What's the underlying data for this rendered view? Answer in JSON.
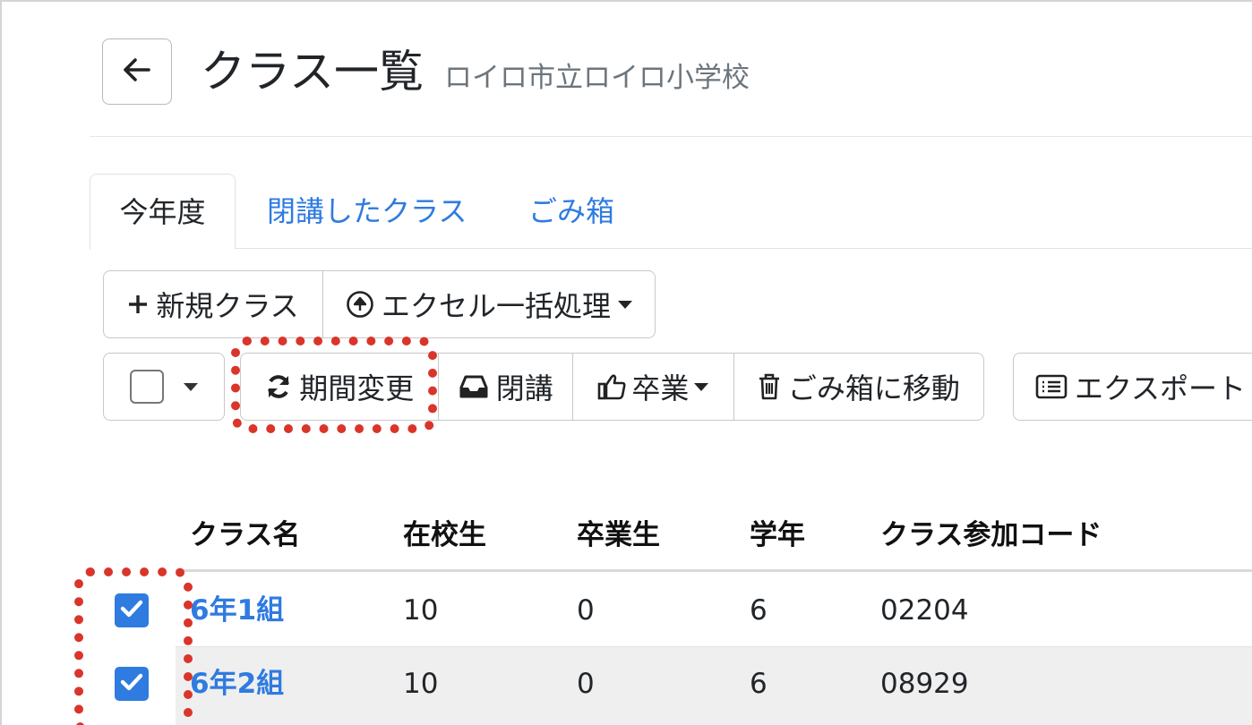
{
  "header": {
    "title": "クラス一覧",
    "school": "ロイロ市立ロイロ小学校"
  },
  "tabs": [
    {
      "label": "今年度",
      "active": true
    },
    {
      "label": "閉講したクラス",
      "active": false
    },
    {
      "label": "ごみ箱",
      "active": false
    }
  ],
  "toolbar": {
    "new_class": "新規クラス",
    "excel_bulk": "エクセル一括処理",
    "period_change": "期間変更",
    "close_class": "閉講",
    "graduate": "卒業",
    "move_to_trash": "ごみ箱に移動",
    "export": "エクスポート"
  },
  "table": {
    "headers": [
      "クラス名",
      "在校生",
      "卒業生",
      "学年",
      "クラス参加コード"
    ],
    "rows": [
      {
        "name": "6年1組",
        "students": "10",
        "graduates": "0",
        "grade": "6",
        "code": "02204",
        "checked": true
      },
      {
        "name": "6年2組",
        "students": "10",
        "graduates": "0",
        "grade": "6",
        "code": "08929",
        "checked": true
      }
    ]
  },
  "colors": {
    "link": "#2f7be0",
    "highlight": "#d9352a",
    "checkbox": "#2f7be0"
  },
  "icons": [
    "arrow-left-icon",
    "plus-icon",
    "upload-circle-icon",
    "sync-icon",
    "inbox-icon",
    "thumbs-up-icon",
    "trash-icon",
    "list-icon",
    "check-icon"
  ]
}
